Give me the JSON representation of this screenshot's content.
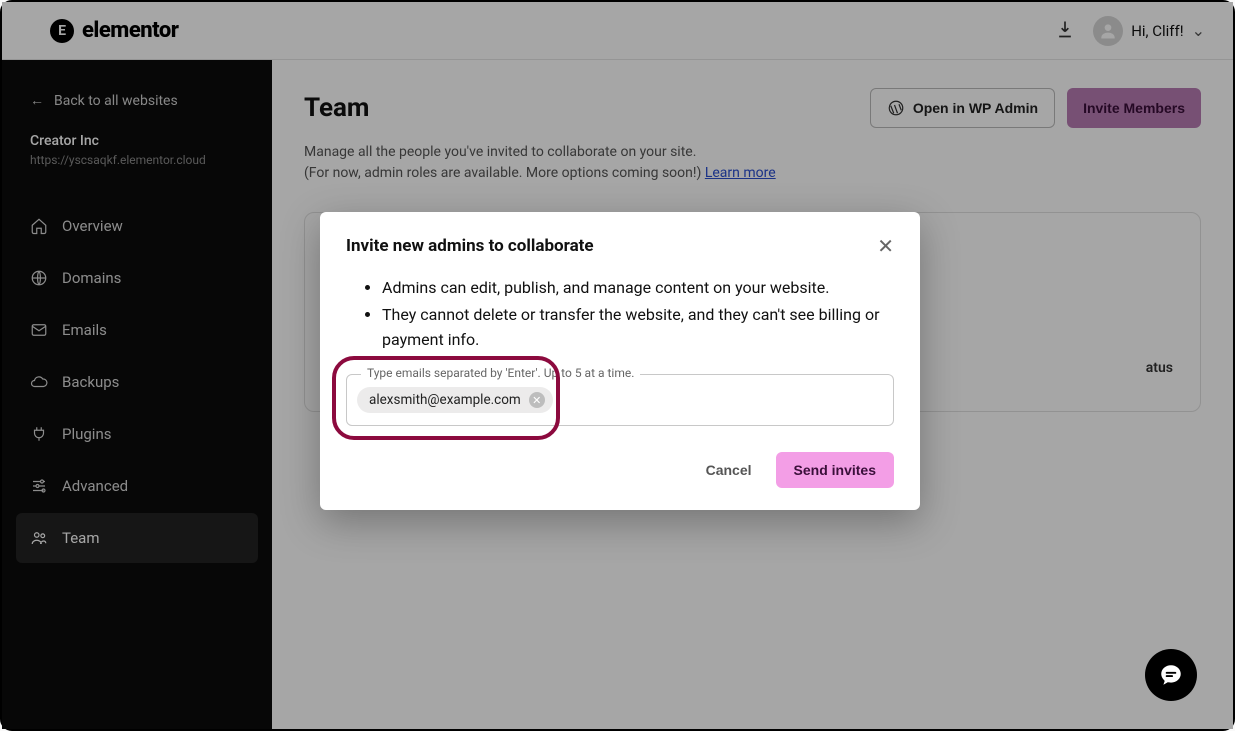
{
  "topbar": {
    "brand": "elementor",
    "greeting": "Hi, Cliff!"
  },
  "sidebar": {
    "back_label": "Back to all websites",
    "site_name": "Creator Inc",
    "site_url": "https://yscsaqkf.elementor.cloud",
    "items": [
      {
        "label": "Overview"
      },
      {
        "label": "Domains"
      },
      {
        "label": "Emails"
      },
      {
        "label": "Backups"
      },
      {
        "label": "Plugins"
      },
      {
        "label": "Advanced"
      },
      {
        "label": "Team"
      }
    ]
  },
  "page": {
    "title": "Team",
    "open_wp_admin": "Open in WP Admin",
    "invite_members": "Invite Members",
    "subtitle_line1": "Manage all the people you've invited to collaborate on your site.",
    "subtitle_line2": "(For now, admin roles are available. More options coming soon!) ",
    "learn_more": "Learn more",
    "table_col_status": "atus"
  },
  "modal": {
    "title": "Invite new admins to collaborate",
    "bullet1": "Admins can edit, publish, and manage content on your website.",
    "bullet2": "They cannot delete or transfer the website, and they can't see billing or payment info.",
    "field_label": "Type emails separated by 'Enter'. Up to 5 at a time.",
    "chip_email": "alexsmith@example.com",
    "cancel": "Cancel",
    "send": "Send invites"
  }
}
